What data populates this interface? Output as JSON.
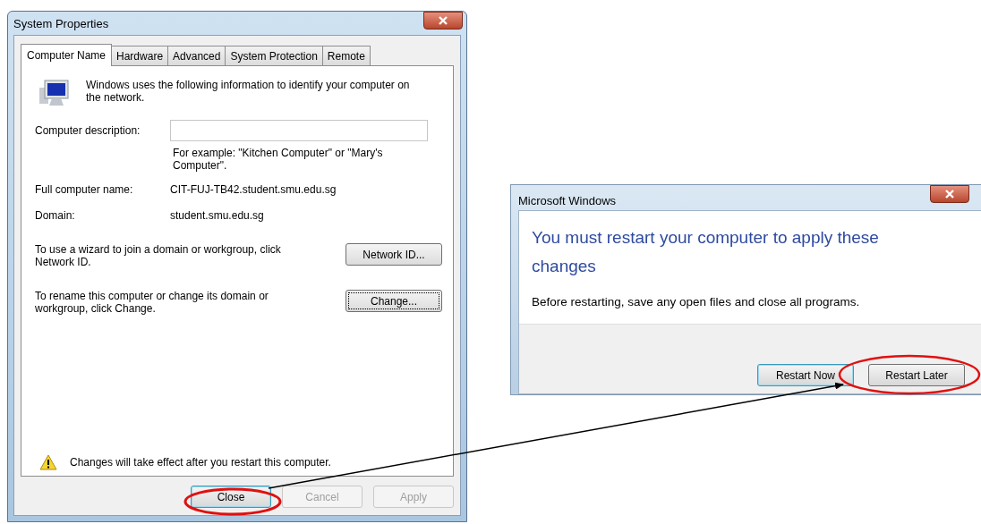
{
  "system_properties": {
    "title": "System Properties",
    "tabs": [
      {
        "label": "Computer Name",
        "selected": true
      },
      {
        "label": "Hardware",
        "selected": false
      },
      {
        "label": "Advanced",
        "selected": false
      },
      {
        "label": "System Protection",
        "selected": false
      },
      {
        "label": "Remote",
        "selected": false
      }
    ],
    "intro": "Windows uses the following information to identify your computer on the network.",
    "description_label": "Computer description:",
    "description_hint": "For example: \"Kitchen Computer\" or \"Mary's Computer\".",
    "info_rows": [
      {
        "label": "Full computer name:",
        "value": "CIT-FUJ-TB42.student.smu.edu.sg"
      },
      {
        "label": "Domain:",
        "value": "student.smu.edu.sg"
      }
    ],
    "actions": [
      {
        "text": "To use a wizard to join a domain or workgroup, click Network ID.",
        "button": "Network ID...",
        "focused": false
      },
      {
        "text": "To rename this computer or change its domain or workgroup, click Change.",
        "button": "Change...",
        "focused": true
      }
    ],
    "notice": "Changes will take effect after you restart this computer.",
    "buttons": [
      {
        "label": "Close",
        "disabled": false,
        "default": true
      },
      {
        "label": "Cancel",
        "disabled": true,
        "default": false
      },
      {
        "label": "Apply",
        "disabled": true,
        "default": false
      }
    ]
  },
  "restart_dialog": {
    "title": "Microsoft Windows",
    "heading": "You must restart your computer to apply these changes",
    "message": "Before restarting, save any open files and close all programs.",
    "buttons": [
      {
        "label": "Restart Now",
        "default": true
      },
      {
        "label": "Restart Later",
        "default": false
      }
    ]
  }
}
